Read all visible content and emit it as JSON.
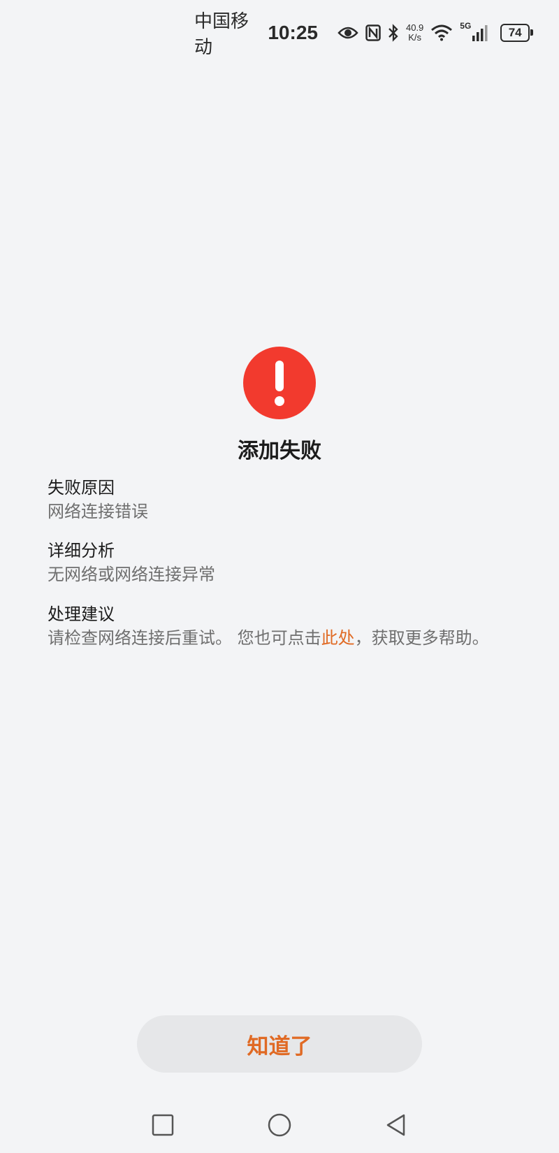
{
  "status_bar": {
    "carrier": "中国移动",
    "time": "10:25",
    "net_speed_value": "40.9",
    "net_speed_unit": "K/s",
    "signal_type": "5G",
    "battery": "74"
  },
  "dialog": {
    "title": "添加失败",
    "sections": [
      {
        "label": "失败原因",
        "value": "网络连接错误"
      },
      {
        "label": "详细分析",
        "value": "无网络或网络连接异常"
      },
      {
        "label": "处理建议",
        "value_before": "请检查网络连接后重试。 您也可点击",
        "link_text": "此处",
        "value_after": "，获取更多帮助。"
      }
    ],
    "confirm_button": "知道了"
  },
  "colors": {
    "error_red": "#f23a2e",
    "accent_orange": "#e06a24",
    "background": "#f3f4f6"
  },
  "icons": {
    "status_bar": [
      "eye-icon",
      "nfc-icon",
      "bluetooth-icon",
      "wifi-icon",
      "cellular-signal-icon",
      "battery-icon"
    ],
    "dialog": "alert-exclamation-icon",
    "nav_bar": [
      "recent-apps-icon",
      "home-icon",
      "back-icon"
    ]
  }
}
